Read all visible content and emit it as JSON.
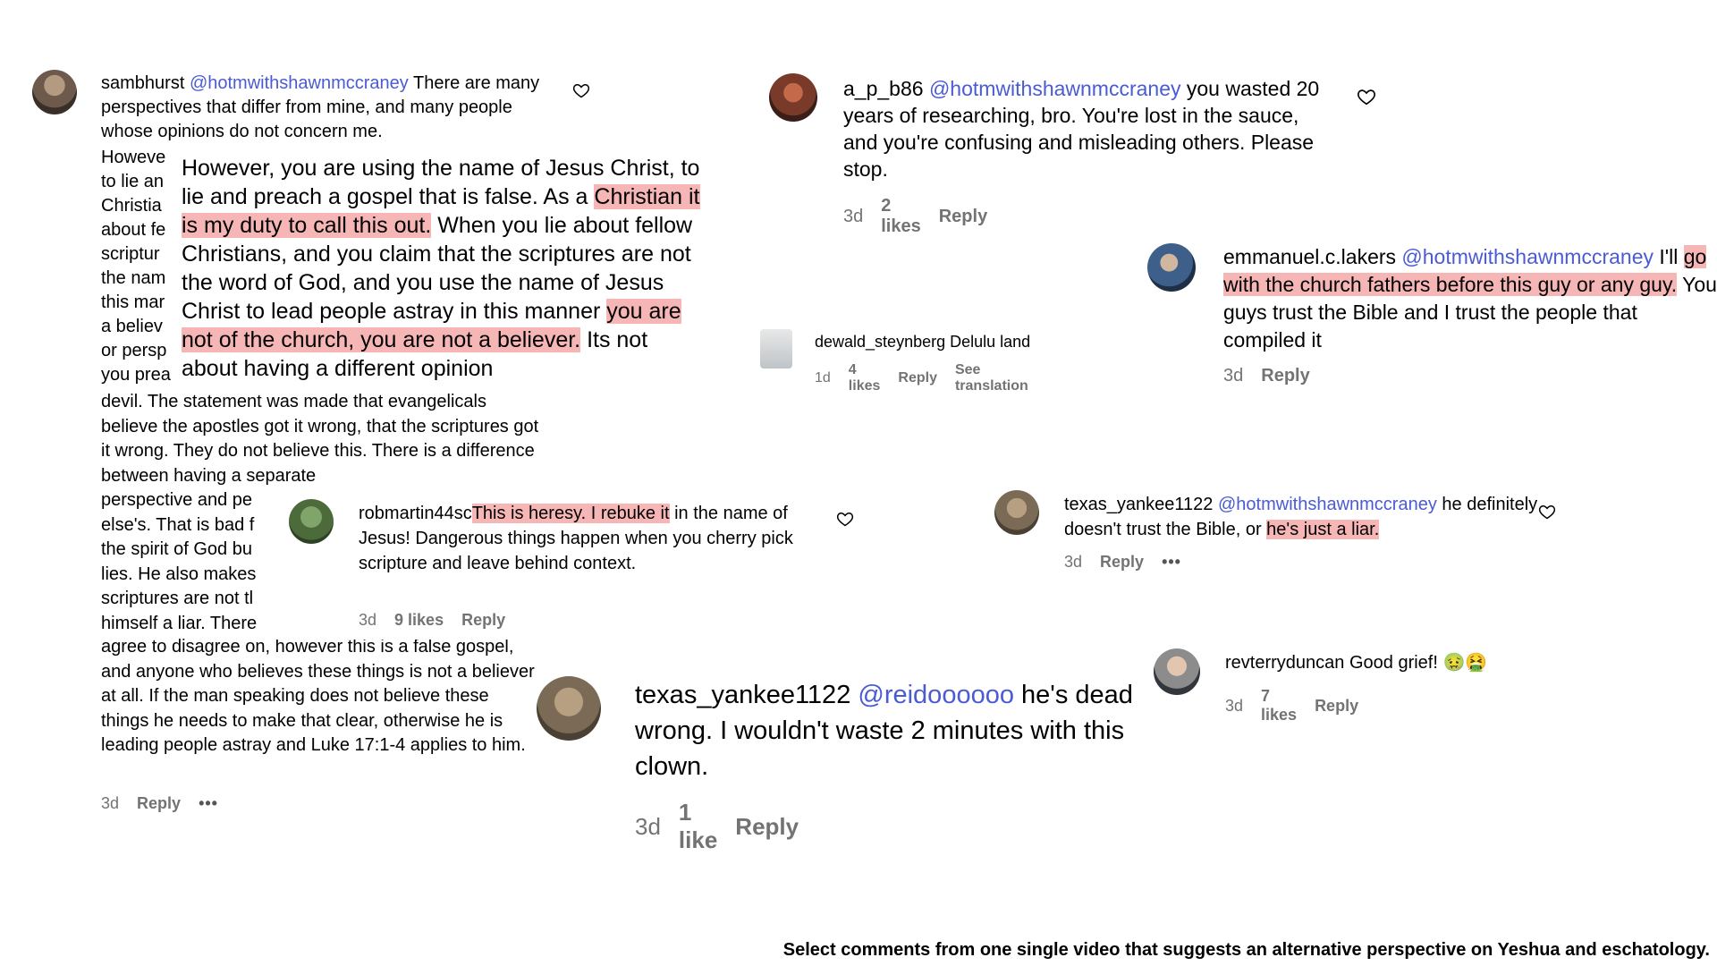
{
  "comments": {
    "sambhurst": {
      "user": "sambhurst",
      "mention": "@hotmwithshawnmccraney",
      "text_a": " There are many perspectives that differ from mine, and many people whose opinions do not concern me.",
      "text_b": "devil. The statement was made that evangelicals believe the apostles got it wrong, that the scriptures got it wrong. They do not believe this. There is a difference between having a separate",
      "text_c": "agree to disagree on, however this is a false gospel, and anyone who believes these things is not a believer at all. If the man speaking does not believe these things he needs to make that clear, otherwise he is leading people astray and Luke 17:1-4 applies to him.",
      "bleed_left": [
        "Howeve",
        "to lie an",
        "Christia",
        "about fe",
        "scriptur",
        "the nam",
        "this mar",
        "a believ",
        "or persp",
        "you prea"
      ],
      "bleed_left2": [
        "perspective and pe",
        "else's. That is bad f",
        "the spirit of God bu",
        "lies. He also makes",
        "scriptures are not tl",
        "himself a liar. There"
      ],
      "time": "3d",
      "reply": "Reply",
      "more": "•••"
    },
    "zoom": {
      "t1": "However, you are using the name of Jesus Christ, to lie and preach a gospel that is false. As a ",
      "h1": "Christian it is my duty to call this out.",
      "t2": " When you lie about fellow Christians, and you claim that the scriptures are not the word of God, and you use the name of Jesus Christ to lead people astray in this manner ",
      "h2": "you are not of the church, you are not a believer.",
      "t3": " Its not about having a different opinion"
    },
    "robmartin": {
      "user": "robmartin44sc",
      "highlight": "This is heresy. I rebuke it",
      "text": " in the name of Jesus! Dangerous things happen when you cherry pick scripture and leave behind context.",
      "time": "3d",
      "likes": "9 likes",
      "reply": "Reply"
    },
    "ap": {
      "user": "a_p_b86",
      "mention": "@hotmwithshawnmccraney",
      "text": " you wasted 20 years of researching, bro. You're lost in the sauce, and you're confusing and misleading others. Please stop.",
      "time": "3d",
      "likes": "2 likes",
      "reply": "Reply"
    },
    "emmanuel": {
      "user": "emmanuel.c.lakers",
      "mention": "@hotmwithshawnmccraney",
      "t1": " I'll ",
      "h1": "go with the church fathers before this guy or any guy.",
      "t2": " You guys trust the Bible and I trust the people that compiled it",
      "time": "3d",
      "reply": "Reply"
    },
    "dewald": {
      "user": "dewald_steynberg",
      "text": " Delulu land",
      "time": "1d",
      "likes": "4 likes",
      "reply": "Reply",
      "translate": "See translation"
    },
    "texas1": {
      "user": "texas_yankee1122",
      "mention": "@hotmwithshawnmccraney",
      "t1": " he definitely doesn't trust the Bible, or ",
      "h1": "he's just a liar.",
      "time": "3d",
      "reply": "Reply",
      "more": "•••"
    },
    "texas2": {
      "user": "texas_yankee1122",
      "mention": "@reidoooooo",
      "text": " he's dead wrong. I wouldn't waste 2 minutes with this clown.",
      "time": "3d",
      "likes": "1 like",
      "reply": "Reply"
    },
    "revterry": {
      "user": "revterryduncan",
      "text": " Good grief! 🤢🤮",
      "time": "3d",
      "likes": "7 likes",
      "reply": "Reply"
    }
  },
  "caption": "Select comments from one single video that suggests an alternative perspective on Yeshua and eschatology.",
  "icons": {
    "like": "heart-outline-icon",
    "more": "more-options-icon"
  },
  "colors": {
    "mention": "#4a5bd4",
    "highlight": "#f7b6b6",
    "meta": "#737373"
  }
}
